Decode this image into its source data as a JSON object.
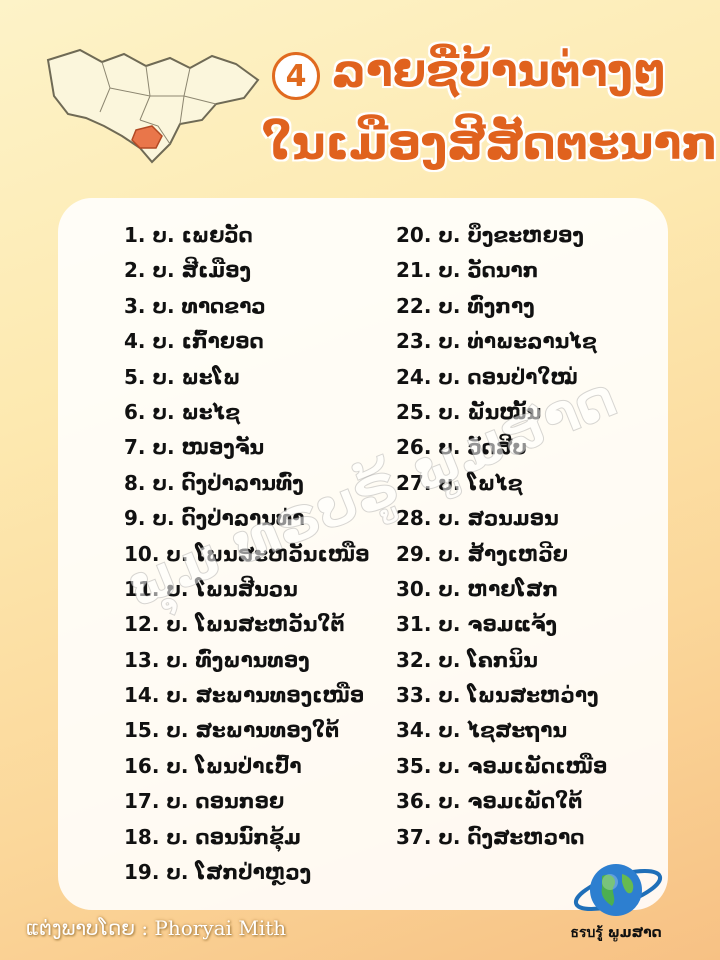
{
  "header": {
    "number": "4",
    "title_line1": "ລາຍຊື່ບ້ານຕ່າງໆ",
    "title_line2": "ໃນເມືອງສີສັດຕະນາກ"
  },
  "villages_left": [
    "1. ບ. ເພຍວັດ",
    "2. ບ. ສີເມືອງ",
    "3. ບ. ທາດຂາວ",
    "4. ບ. ເກົ້າຍອດ",
    "5. ບ. ພະໂພ",
    "6. ບ. ພະໄຊ",
    "7. ບ. ໜອງຈັນ",
    "8. ບ. ດົງປ່າລານທົ່ງ",
    "9. ບ. ດົງປ່າລານທ່າ",
    "10. ບ. ໂພນສະຫວັນເໜືອ",
    "11. ບ. ໂພນສີນວນ",
    "12. ບ. ໂພນສະຫວັນໃຕ້",
    "13. ບ. ທົ່ງພານທອງ",
    "14. ບ. ສະພານທອງເໜືອ",
    "15. ບ. ສະພານທອງໃຕ້",
    "16. ບ. ໂພນປ່າເປົ້າ",
    "17. ບ. ດອນກອຍ",
    "18. ບ. ດອນນົກຂຸ້ມ",
    "19. ບ. ໂສກປ່າຫຼວງ"
  ],
  "villages_right": [
    "20. ບ. ບຶງຂະຫຍອງ",
    "21. ບ. ວັດນາກ",
    "22. ບ. ທົ່ງກາງ",
    "23. ບ. ທ່າພະລານໄຊ",
    "24. ບ. ດອນປ່າໃໝ່",
    "25. ບ. ພັນໝັ້ນ",
    "26. ບ. ວັດສີບ",
    "27. ບ. ໂພໄຊ",
    "28. ບ. ສວນມອນ",
    "29. ບ. ສ້າງເຫວີຍ",
    "30. ບ. ຫາຍໂສກ",
    "31. ບ. ຈອມແຈ້ງ",
    "32. ບ. ໂຄກນິນ",
    "33. ບ. ໂພນສະຫວ່າງ",
    "34. ບ. ໄຊສະຖານ",
    "35. ບ. ຈອມເພັດເໜືອ",
    "36. ບ. ຈອມເພັດໃຕ້",
    "37. ບ. ດົງສະຫວາດ"
  ],
  "watermark": "ພຸມ ທຣບຣູ້ ພູມສາດ",
  "footer": {
    "credit": "ແຕ່ງພາບໂດຍ : Phoryai Mith",
    "logo_text": "ธรบรู้ ພູມສາດ"
  },
  "colors": {
    "title": "#e0621e",
    "map_fill": "#fbf6dc",
    "map_highlight": "#e9764a"
  }
}
